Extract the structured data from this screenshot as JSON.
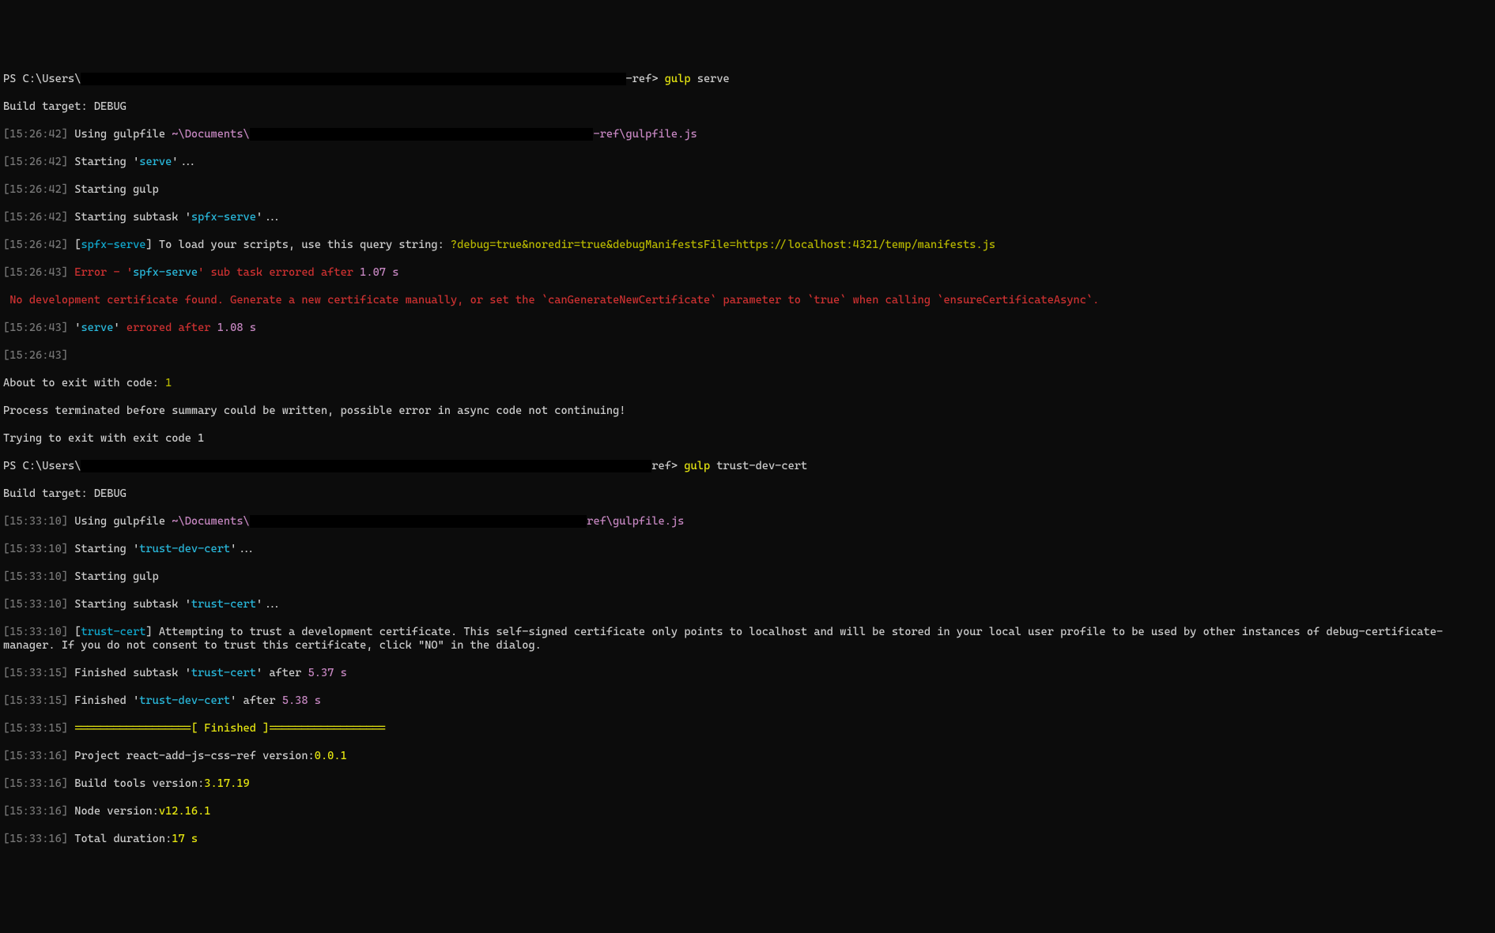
{
  "prompt1": {
    "ps": "PS ",
    "path_prefix": "C:\\Users\\",
    "path_suffix": "-ref>",
    "cmd": "gulp",
    "arg": "serve"
  },
  "build_target1": "Build target: DEBUG",
  "l1": {
    "ts": "[15:26:42]",
    "txt": " Using gulpfile ",
    "path_pre": "~\\Documents\\",
    "path_suf": "-ref\\gulpfile.js"
  },
  "l2": {
    "ts": "[15:26:42]",
    "txt": " Starting '",
    "task": "serve",
    "rest": "'..."
  },
  "l3": {
    "ts": "[15:26:42]",
    "txt": " Starting gulp"
  },
  "l4": {
    "ts": "[15:26:42]",
    "txt": " Starting subtask '",
    "task": "spfx-serve",
    "rest": "'..."
  },
  "l5": {
    "ts": "[15:26:42]",
    "br": " [",
    "tag": "spfx-serve",
    "br2": "] ",
    "msg": "To load your scripts, use this query string: ",
    "url": "?debug=true&noredir=true&debugManifestsFile=https://localhost:4321/temp/manifests.js"
  },
  "l6": {
    "ts": "[15:26:43]",
    "err": " Error - '",
    "task": "spfx-serve",
    "rest": "' sub task errored after ",
    "dur": "1.07 s"
  },
  "l7": {
    "msg": " No development certificate found. Generate a new certificate manually, or set the `canGenerateNewCertificate` parameter to `true` when calling `ensureCertificateAsync`."
  },
  "l8": {
    "ts": "[15:26:43]",
    "sp": " '",
    "task": "serve",
    "rest": "' ",
    "err": "errored after ",
    "dur": "1.08 s"
  },
  "l9": {
    "ts": "[15:26:43]"
  },
  "l10": {
    "txt": "About to exit with code: ",
    "code": "1"
  },
  "l11": "Process terminated before summary could be written, possible error in async code not continuing!",
  "l12": "Trying to exit with exit code 1",
  "prompt2": {
    "ps": "PS ",
    "path_prefix": "C:\\Users\\",
    "path_suffix": "ref>",
    "cmd": "gulp",
    "arg": "trust-dev-cert"
  },
  "build_target2": "Build target: DEBUG",
  "m1": {
    "ts": "[15:33:10]",
    "txt": " Using gulpfile ",
    "path_pre": "~\\Documents\\",
    "path_suf": "ref\\gulpfile.js"
  },
  "m2": {
    "ts": "[15:33:10]",
    "txt": " Starting '",
    "task": "trust-dev-cert",
    "rest": "'..."
  },
  "m3": {
    "ts": "[15:33:10]",
    "txt": " Starting gulp"
  },
  "m4": {
    "ts": "[15:33:10]",
    "txt": " Starting subtask '",
    "task": "trust-cert",
    "rest": "'..."
  },
  "m5": {
    "ts": "[15:33:10]",
    "br": " [",
    "tag": "trust-cert",
    "br2": "] ",
    "msg": "Attempting to trust a development certificate. This self-signed certificate only points to localhost and will be stored in your local user profile to be used by other instances of debug-certificate-manager. If you do not consent to trust this certificate, click \"NO\" in the dialog."
  },
  "m6": {
    "ts": "[15:33:15]",
    "txt": " Finished subtask '",
    "task": "trust-cert",
    "rest": "' after ",
    "dur": "5.37 s"
  },
  "m7": {
    "ts": "[15:33:15]",
    "txt": " Finished '",
    "task": "trust-dev-cert",
    "rest": "' after ",
    "dur": "5.38 s"
  },
  "m8": {
    "ts": "[15:33:15]",
    "sep": " ==================[ Finished ]=================="
  },
  "m9": {
    "ts": "[15:33:16]",
    "txt": " Project react-add-js-css-ref version:",
    "val": "0.0.1"
  },
  "m10": {
    "ts": "[15:33:16]",
    "txt": " Build tools version:",
    "val": "3.17.19"
  },
  "m11": {
    "ts": "[15:33:16]",
    "txt": " Node version:",
    "val": "v12.16.1"
  },
  "m12": {
    "ts": "[15:33:16]",
    "txt": " Total duration:",
    "val": "17 s"
  }
}
